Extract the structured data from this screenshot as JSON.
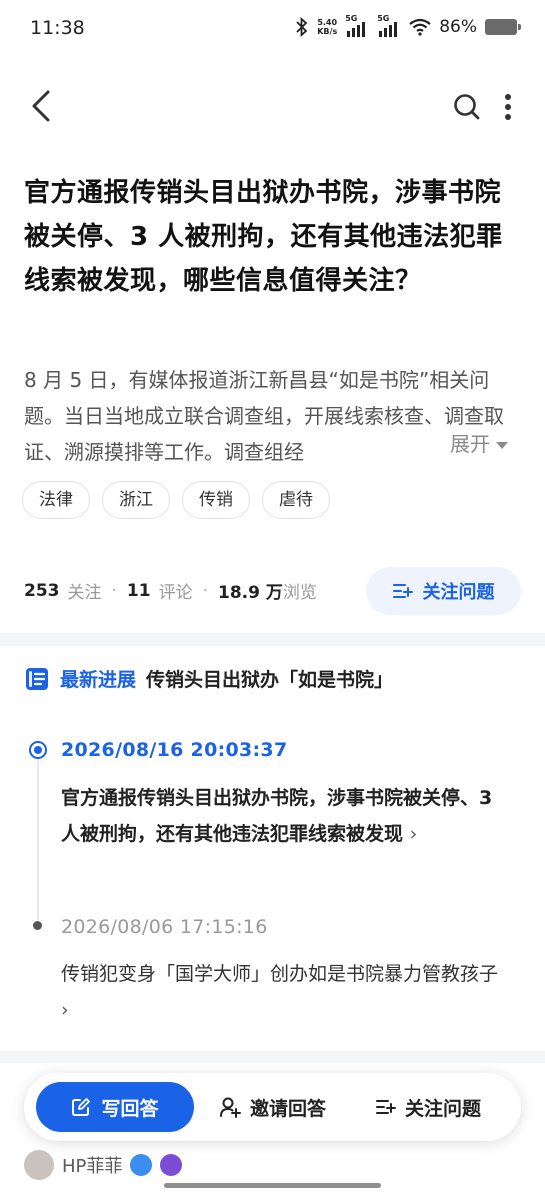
{
  "status_bar": {
    "time": "11:38",
    "net_speed_value": "5.40",
    "net_speed_unit": "KB/s",
    "sim1": "5G",
    "sim2": "5G",
    "battery": "86%"
  },
  "nav": {
    "back_icon": "back-arrow-icon",
    "search_icon": "search-icon",
    "more_icon": "more-vertical-icon"
  },
  "question": {
    "title": "官方通报传销头目出狱办书院，涉事书院被关停、3 人被刑拘，还有其他违法犯罪线索被发现，哪些信息值得关注？",
    "summary": "8 月 5 日，有媒体报道浙江新昌县“如是书院”相关问题。当日当地成立联合调查组，开展线索核查、调查取证、溯源摸排等工作。调查组经",
    "expand_label": "展开",
    "tags": [
      "法律",
      "浙江",
      "传销",
      "虐待"
    ]
  },
  "stats": {
    "followers": "253",
    "followers_label": "关注",
    "comments": "11",
    "comments_label": "评论",
    "views": "18.9 万",
    "views_label": "浏览",
    "separator": "·"
  },
  "follow_button_label": "关注问题",
  "latest": {
    "label": "最新进展",
    "topic": "传销头目出狱办「如是书院」",
    "items": [
      {
        "time": "2026/08/16  20:03:37",
        "text": "官方通报传销头目出狱办书院，涉事书院被关停、3 人被刑拘，还有其他违法犯罪线索被发现",
        "chevron": "›"
      },
      {
        "time": "2026/08/06  17:15:16",
        "text": "传销犯变身「国学大师」创办如是书院暴力管教孩子",
        "chevron": "›"
      }
    ]
  },
  "actions": {
    "write": "写回答",
    "invite": "邀请回答",
    "follow": "关注问题"
  },
  "peek": {
    "username": "HP菲菲"
  },
  "colors": {
    "accent": "#1a62e6",
    "accent_soft": "#eef3fd",
    "divider": "#f4f5f7"
  }
}
